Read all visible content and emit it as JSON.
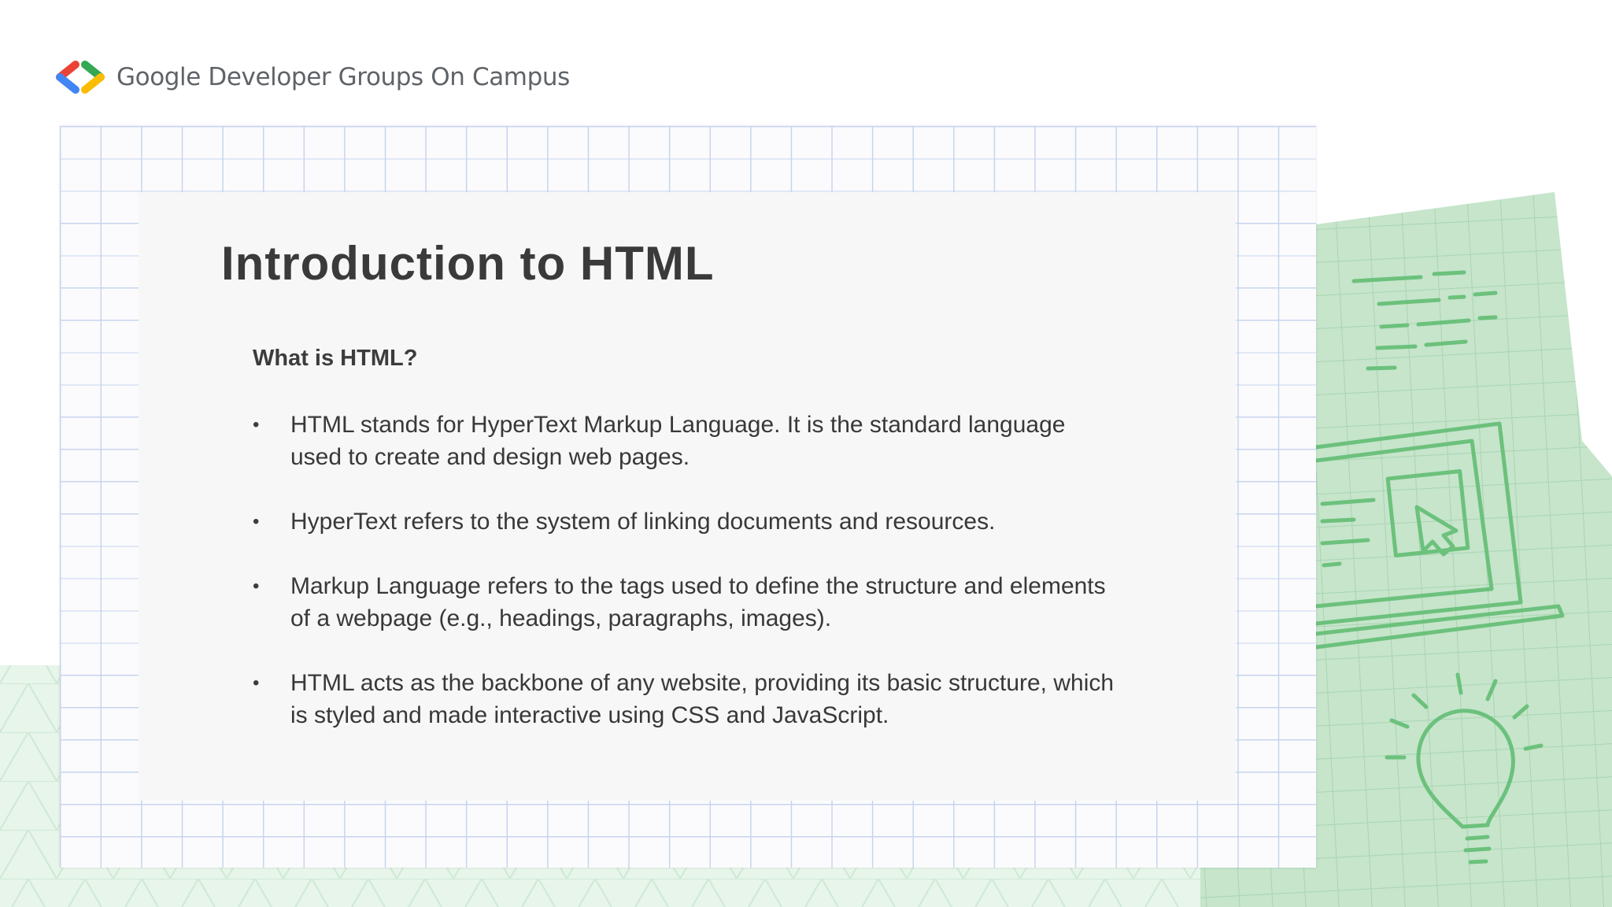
{
  "header": {
    "brand_text": "Google Developer Groups On Campus",
    "logo_icon": "gdg-chevrons-logo-icon",
    "logo_colors": [
      "#ea4335",
      "#4285f4",
      "#34a853",
      "#fbbc04"
    ]
  },
  "slide": {
    "title": "Introduction to HTML",
    "subheading": "What is HTML?",
    "bullet_marker": "•",
    "bullets": [
      {
        "text": "HTML stands for HyperText Markup Language. It is the standard language used to create and design web pages."
      },
      {
        "text": "HyperText refers to the system of linking documents and resources."
      },
      {
        "text": "Markup Language refers to the tags used to define the structure and elements of a webpage (e.g., headings, paragraphs, images)."
      },
      {
        "text": "HTML acts as the backbone of any website, providing its basic structure, which is styled and made interactive using CSS and JavaScript."
      }
    ]
  },
  "theme": {
    "accent_green": "#34a853",
    "grid_blue": "#c7d4ee",
    "decor_icons": [
      "code-lines-icon",
      "laptop-cursor-icon",
      "lightbulb-icon"
    ]
  }
}
